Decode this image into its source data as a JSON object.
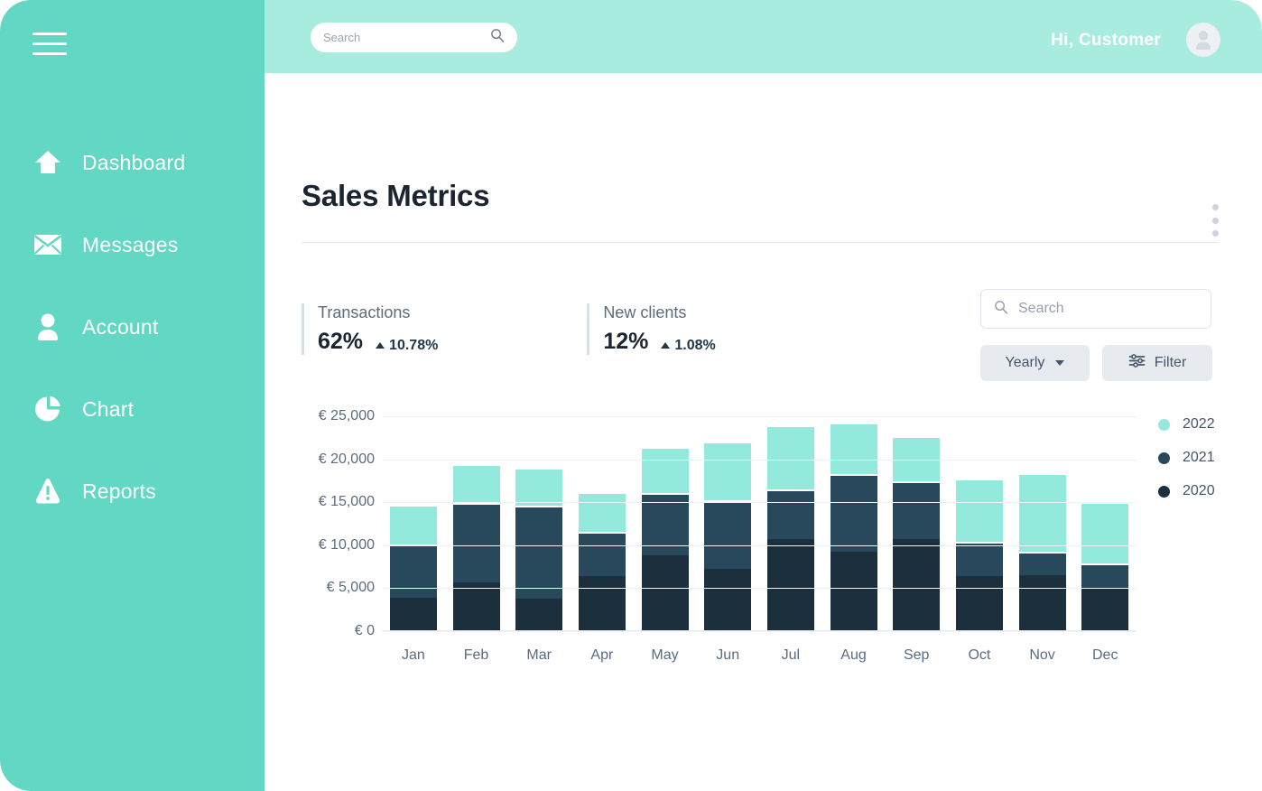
{
  "sidebar": {
    "menu_icon": "hamburger-icon",
    "items": [
      {
        "label": "Dashboard",
        "icon": "home-icon"
      },
      {
        "label": "Messages",
        "icon": "envelope-icon"
      },
      {
        "label": "Account",
        "icon": "user-icon"
      },
      {
        "label": "Chart",
        "icon": "pie-chart-icon"
      },
      {
        "label": "Reports",
        "icon": "warning-icon"
      }
    ]
  },
  "topbar": {
    "search": {
      "value": "",
      "placeholder": "Search",
      "icon": "search-icon"
    },
    "greeting": "Hi, Customer",
    "avatar_icon": "user-avatar-icon"
  },
  "page": {
    "title": "Sales Metrics",
    "overflow_icon": "kebab-menu-icon"
  },
  "metrics": [
    {
      "label": "Transactions",
      "value": "62%",
      "delta": "10.78%",
      "direction": "up"
    },
    {
      "label": "New clients",
      "value": "12%",
      "delta": "1.08%",
      "direction": "up"
    }
  ],
  "controls": {
    "search": {
      "value": "",
      "placeholder": "Search",
      "icon": "search-icon"
    },
    "period_label": "Yearly",
    "period_icon": "chevron-down-icon",
    "filter_label": "Filter",
    "filter_icon": "sliders-icon"
  },
  "colors": {
    "sidebar": "#62d7c4",
    "topbar": "#a8ece0",
    "series_2022": "#92e9dc",
    "series_2021": "#28485c",
    "series_2020": "#1b2f3d",
    "title": "#1b2430"
  },
  "chart_data": {
    "type": "bar",
    "stacked": true,
    "title": "",
    "xlabel": "",
    "ylabel": "",
    "ylim": [
      0,
      25000
    ],
    "grid": true,
    "legend_position": "right",
    "currency_prefix": "€ ",
    "ytick_labels": [
      "€ 25,000",
      "€ 20,000",
      "€ 15,000",
      "€ 10,000",
      "€ 5,000",
      "€ 0"
    ],
    "yticks": [
      25000,
      20000,
      15000,
      10000,
      5000,
      0
    ],
    "categories": [
      "Jan",
      "Feb",
      "Mar",
      "Apr",
      "May",
      "Jun",
      "Jul",
      "Aug",
      "Sep",
      "Oct",
      "Nov",
      "Dec"
    ],
    "series": [
      {
        "name": "2020",
        "color": "#1b2f3d",
        "values": [
          3900,
          5700,
          3800,
          6400,
          8800,
          7200,
          10700,
          9200,
          10700,
          6400,
          6500,
          4900
        ]
      },
      {
        "name": "2021",
        "color": "#28485c",
        "values": [
          6200,
          9200,
          10800,
          5200,
          7300,
          8000,
          5800,
          9100,
          6700,
          4000,
          2700,
          3000
        ]
      },
      {
        "name": "2022",
        "color": "#92e9dc",
        "values": [
          4600,
          4500,
          4400,
          4600,
          5300,
          6900,
          7500,
          6000,
          5300,
          7400,
          9200,
          7100
        ]
      }
    ]
  }
}
